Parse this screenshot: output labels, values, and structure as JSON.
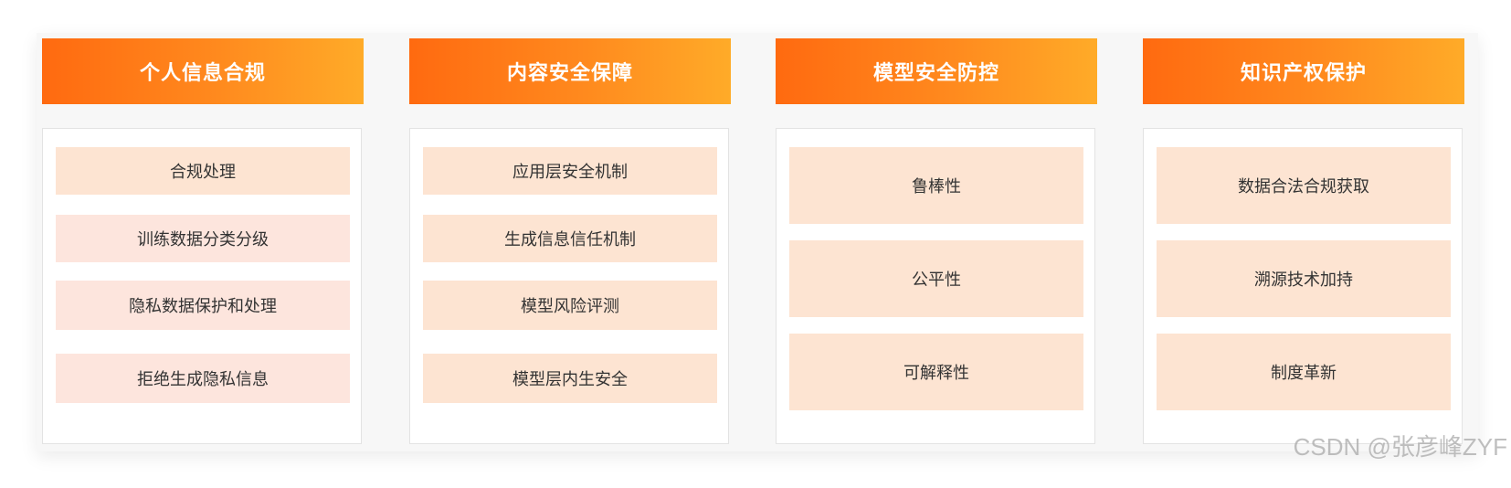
{
  "columns": [
    {
      "title": "个人信息合规",
      "items": [
        "合规处理",
        "训练数据分类分级",
        "隐私数据保护和处理",
        "拒绝生成隐私信息"
      ]
    },
    {
      "title": "内容安全保障",
      "items": [
        "应用层安全机制",
        "生成信息信任机制",
        "模型风险评测",
        "模型层内生安全"
      ]
    },
    {
      "title": "模型安全防控",
      "items": [
        "鲁棒性",
        "公平性",
        "可解释性"
      ]
    },
    {
      "title": "知识产权保护",
      "items": [
        "数据合法合规获取",
        "溯源技术加持",
        "制度革新"
      ]
    }
  ],
  "watermark": "CSDN @张彦峰ZYF",
  "colors": {
    "header_gradient_start": "#ff6a10",
    "header_gradient_end": "#ffab28",
    "item_bg": "#fde4d2",
    "item_bg_pink": "#fde5dd",
    "text": "#333333"
  }
}
